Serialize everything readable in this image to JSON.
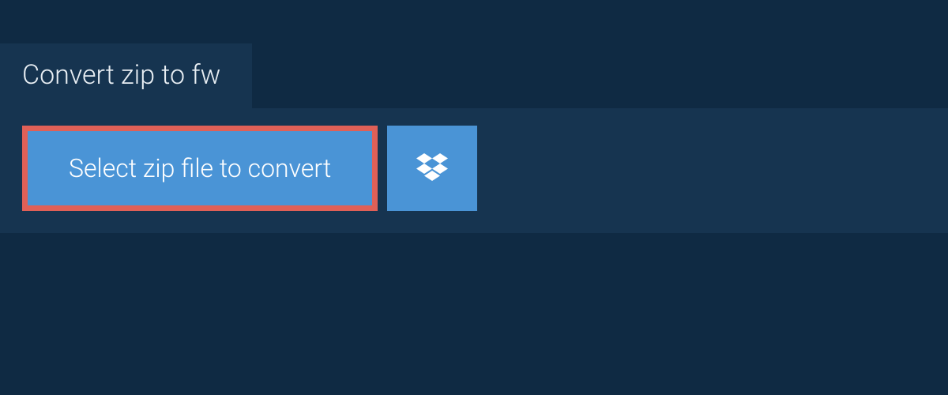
{
  "tab": {
    "title": "Convert zip to fw"
  },
  "actions": {
    "select_label": "Select zip file to convert",
    "dropbox_icon": "dropbox-icon"
  },
  "colors": {
    "page_bg": "#0f2a43",
    "panel_bg": "#163450",
    "button_bg": "#4a94d6",
    "highlight_border": "#e06057",
    "text_light": "#e8eef3",
    "text_white": "#ffffff"
  }
}
